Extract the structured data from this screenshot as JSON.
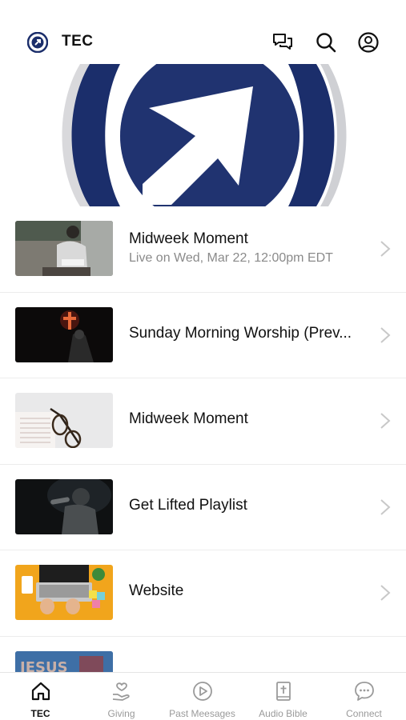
{
  "header": {
    "title": "TEC",
    "icons": [
      "logo-icon",
      "chat-icon",
      "search-icon",
      "profile-icon"
    ]
  },
  "colors": {
    "brand_navy": "#1b2e6b",
    "chevron": "#c8c8c8",
    "inactive_tab": "#9a9a9a"
  },
  "feed": {
    "items": [
      {
        "title": "Midweek Moment",
        "subtitle": "Live on Wed, Mar 22, 12:00pm EDT",
        "thumb": "man-writing-thumbnail"
      },
      {
        "title": "Sunday Morning Worship (Prev...",
        "thumb": "worship-cross-thumbnail"
      },
      {
        "title": "Midweek Moment",
        "thumb": "bible-glasses-thumbnail"
      },
      {
        "title": "Get Lifted Playlist",
        "thumb": "singer-microphone-thumbnail"
      },
      {
        "title": "Website",
        "thumb": "laptop-desk-thumbnail"
      },
      {
        "title": "",
        "thumb": "jesus-banner-thumbnail"
      }
    ]
  },
  "tabbar": {
    "tabs": [
      {
        "label": "TEC",
        "icon": "home-icon",
        "active": true
      },
      {
        "label": "Giving",
        "icon": "giving-hand-icon"
      },
      {
        "label": "Past Meesages",
        "icon": "play-circle-icon"
      },
      {
        "label": "Audio Bible",
        "icon": "bible-icon"
      },
      {
        "label": "Connect",
        "icon": "chat-bubble-icon"
      }
    ]
  }
}
